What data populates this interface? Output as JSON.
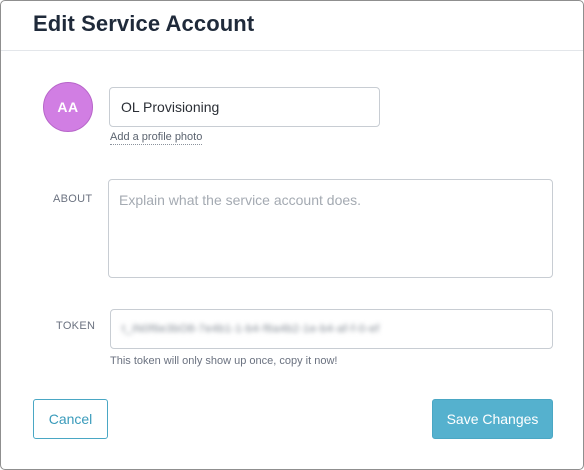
{
  "dialog": {
    "title": "Edit Service Account"
  },
  "avatar": {
    "initials": "AA",
    "color": "#d17ee3"
  },
  "name_field": {
    "value": "OL Provisioning"
  },
  "add_photo_link": "Add a profile photo",
  "about": {
    "label": "ABOUT",
    "placeholder": "Explain what the service account does.",
    "value": ""
  },
  "token": {
    "label": "TOKEN",
    "value": "t_iN0f6e3bO8-7e4b1-1-b4-f6a4b2-1e-b4-af-f-0-ef",
    "hint": "This token will only show up once, copy it now!"
  },
  "buttons": {
    "cancel": "Cancel",
    "save": "Save Changes"
  },
  "colors": {
    "accent": "#55b1ce",
    "title": "#1f2a3a"
  }
}
